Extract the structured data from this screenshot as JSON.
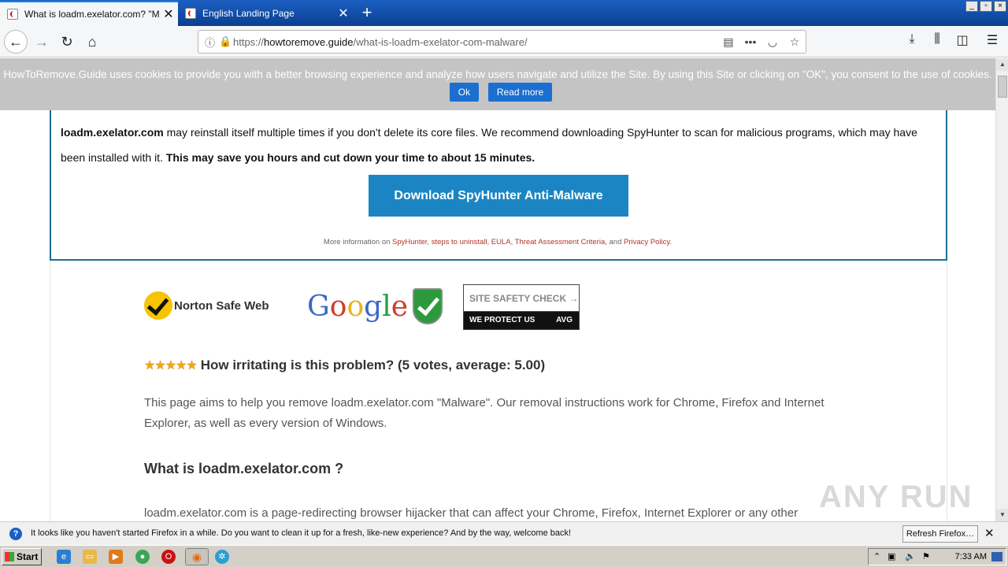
{
  "browser": {
    "tabs": [
      {
        "title": "What is loadm.exelator.com? \"Mal",
        "active": true
      },
      {
        "title": "English Landing Page",
        "active": false
      }
    ],
    "new_tab": "+",
    "window_controls": [
      "_",
      "▫",
      "×"
    ],
    "url_scheme": "https://",
    "url_host": "howtoremove.guide",
    "url_path": "/what-is-loadm-exelator-com-malware/"
  },
  "cookie_banner": {
    "text": "HowToRemove.Guide uses cookies to provide you with a better browsing experience and analyze how users navigate and utilize the Site. By using this Site or clicking on \"OK\", you consent to the use of cookies.",
    "ok_label": "Ok",
    "read_more_label": "Read more"
  },
  "box": {
    "p1_bold": "loadm.exelator.com",
    "p1_rest": " may reinstall itself multiple times if you don't delete its core files. We recommend downloading SpyHunter to scan for malicious programs, which may have been installed with it. ",
    "p1_bold_end": "This may save you hours and cut down your time to about 15 minutes.",
    "download_label": "Download SpyHunter Anti-Malware",
    "more_prefix": "More information on ",
    "link_spyhunter": "SpyHunter",
    "sep1": ", ",
    "link_uninstall": "steps to uninstall",
    "sep2": ", ",
    "link_eula": "EULA",
    "sep3": ", ",
    "link_threat": "Threat Assessment Criteria",
    "sep4": ", and ",
    "link_privacy": "Privacy Policy",
    "end": "."
  },
  "badges": {
    "norton": "Norton Safe Web",
    "google_letters": [
      "G",
      "o",
      "o",
      "g",
      "l",
      "e"
    ],
    "avg_top": "SITE SAFETY CHECK →",
    "avg_bottom": "WE PROTECT US",
    "avg_logo": "AVG"
  },
  "rating": {
    "stars": "★★★★★",
    "text": "How irritating is this problem? (5 votes, average: 5.00)"
  },
  "article": {
    "intro": "This page aims to help you remove loadm.exelator.com \"Malware\". Our removal instructions work for Chrome, Firefox and Internet Explorer, as well as every version of Windows.",
    "heading": "What is loadm.exelator.com ?",
    "para2": "loadm.exelator.com is a page-redirecting browser hijacker that can affect your Chrome, Firefox, Internet Explorer or any other"
  },
  "watermark": "ANY RUN",
  "notification": {
    "message": "It looks like you haven't started Firefox in a while. Do you want to clean it up for a fresh, like-new experience? And by the way, welcome back!",
    "button": "Refresh Firefox…",
    "close": "✕"
  },
  "taskbar": {
    "start": "Start",
    "clock": "7:33 AM"
  }
}
